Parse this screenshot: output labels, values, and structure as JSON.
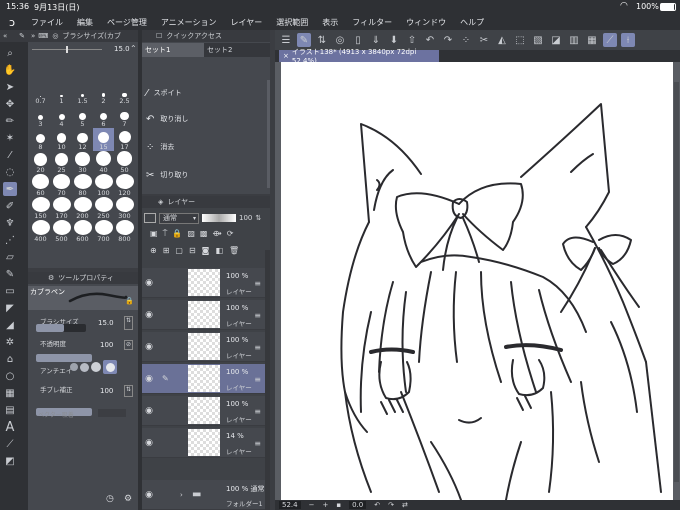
{
  "status": {
    "time": "15:36",
    "date": "9月13日(日)",
    "battery": "100%"
  },
  "menu": [
    "ファイル",
    "編集",
    "ページ管理",
    "アニメーション",
    "レイヤー",
    "選択範囲",
    "表示",
    "フィルター",
    "ウィンドウ",
    "ヘルプ"
  ],
  "brush_size_panel": {
    "title": "ブラシサイズ(カブ",
    "value": "15.0",
    "sizes": [
      "0.7",
      "1",
      "1.5",
      "2",
      "2.5",
      "3",
      "4",
      "5",
      "6",
      "7",
      "8",
      "10",
      "12",
      "15",
      "17",
      "20",
      "25",
      "30",
      "40",
      "50",
      "60",
      "70",
      "80",
      "100",
      "120",
      "150",
      "170",
      "200",
      "250",
      "300",
      "400",
      "500",
      "600",
      "700",
      "800"
    ],
    "selected": "15"
  },
  "tool_property": {
    "title": "ツールプロパティ",
    "brush_name": "カブラペン",
    "brush_size_label": "ブラシサイズ",
    "brush_size_value": "15.0",
    "brush_size_fraction": 0.55,
    "opacity_label": "不透明度",
    "opacity_value": "100",
    "opacity_fraction": 1.0,
    "antialias_label": "アンチエイ",
    "stabilization_label": "手ブレ補正",
    "stabilization_value": "100",
    "stabilization_fraction": 1.0,
    "vector_label": "ベクター吸着"
  },
  "quick_access": {
    "title": "クイックアクセス",
    "tabs": [
      "セット1",
      "セット2"
    ],
    "items": [
      {
        "icon": "eyedropper-icon",
        "label": "スポイト"
      },
      {
        "icon": "undo-icon",
        "label": "取り消し"
      },
      {
        "icon": "erase-icon",
        "label": "消去"
      },
      {
        "icon": "scissors-icon",
        "label": "切り取り"
      }
    ]
  },
  "layer_panel": {
    "title": "レイヤー",
    "blend_mode": "通常",
    "opacity": "100",
    "layers": [
      {
        "pct": "100 %",
        "name": "レイヤー",
        "selected": false,
        "pen": false
      },
      {
        "pct": "100 %",
        "name": "レイヤー",
        "selected": false,
        "pen": false
      },
      {
        "pct": "100 %",
        "name": "レイヤー",
        "selected": false,
        "pen": false
      },
      {
        "pct": "100 %",
        "name": "レイヤー",
        "selected": true,
        "pen": true
      },
      {
        "pct": "100 %",
        "name": "レイヤー",
        "selected": false,
        "pen": false
      },
      {
        "pct": "14 %",
        "name": "レイヤー",
        "selected": false,
        "pen": false
      }
    ],
    "folder": {
      "pct": "100 % 通常",
      "name": "フォルダー1"
    }
  },
  "canvas": {
    "tab_title": "イラスト138* (4913 x 3840px 72dpi 52.4%)",
    "zoom": "52.4",
    "rotation": "0.0"
  },
  "colors": {
    "accent": "#7e88b3",
    "selected_layer": "#6a7197",
    "canvas_tab": "#6c72a0"
  }
}
